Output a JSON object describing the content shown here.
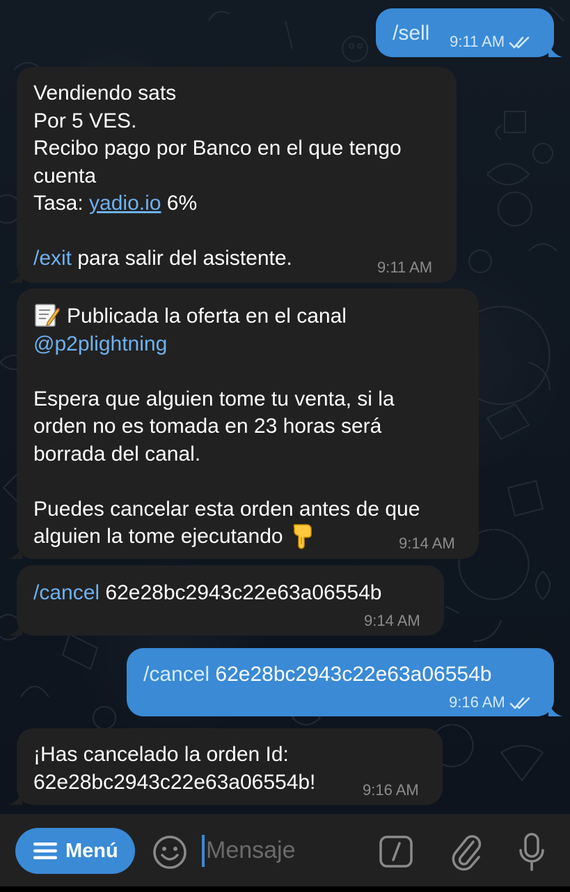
{
  "messages": [
    {
      "id": "m1",
      "direction": "outgoing",
      "command": "/sell",
      "time": "9:11 AM",
      "read": true
    },
    {
      "id": "m2",
      "direction": "incoming",
      "lines": [
        "Vendiendo sats",
        "Por 5 VES.",
        "Recibo pago por Banco en el que tengo",
        "cuenta"
      ],
      "rate_label": "Tasa: ",
      "rate_link": "yadio.io",
      "rate_suffix": " 6%",
      "exit_command": "/exit",
      "exit_text": " para salir del asistente.",
      "time": "9:11 AM"
    },
    {
      "id": "m3",
      "direction": "incoming",
      "line1_text": "Publicada la oferta en el canal",
      "mention": "@p2plightning",
      "para2": [
        "Espera que alguien tome tu venta, si la",
        "orden no es tomada en 23 horas será",
        "borrada del canal."
      ],
      "para3_line1": "Puedes cancelar esta orden antes de que",
      "para3_line2": "alguien la tome ejecutando",
      "time": "9:14 AM"
    },
    {
      "id": "m4",
      "direction": "incoming",
      "command": "/cancel",
      "order_id": " 62e28bc2943c22e63a06554b",
      "time": "9:14 AM"
    },
    {
      "id": "m5",
      "direction": "outgoing",
      "command": "/cancel",
      "order_id": " 62e28bc2943c22e63a06554b",
      "time": "9:16 AM",
      "read": true
    },
    {
      "id": "m6",
      "direction": "incoming",
      "line1": "¡Has cancelado la orden Id:",
      "line2": "62e28bc2943c22e63a06554b!",
      "time": "9:16 AM"
    }
  ],
  "input_bar": {
    "menu_label": "Menú",
    "placeholder": "Mensaje",
    "icons": [
      "menu-lines-icon",
      "emoji-icon",
      "bot-command-icon",
      "paperclip-icon",
      "microphone-icon"
    ]
  },
  "colors": {
    "incoming_bubble": "#212121",
    "outgoing_bubble": "#3a8ad6",
    "link": "#6fb1f0",
    "background": "#0e1621"
  }
}
